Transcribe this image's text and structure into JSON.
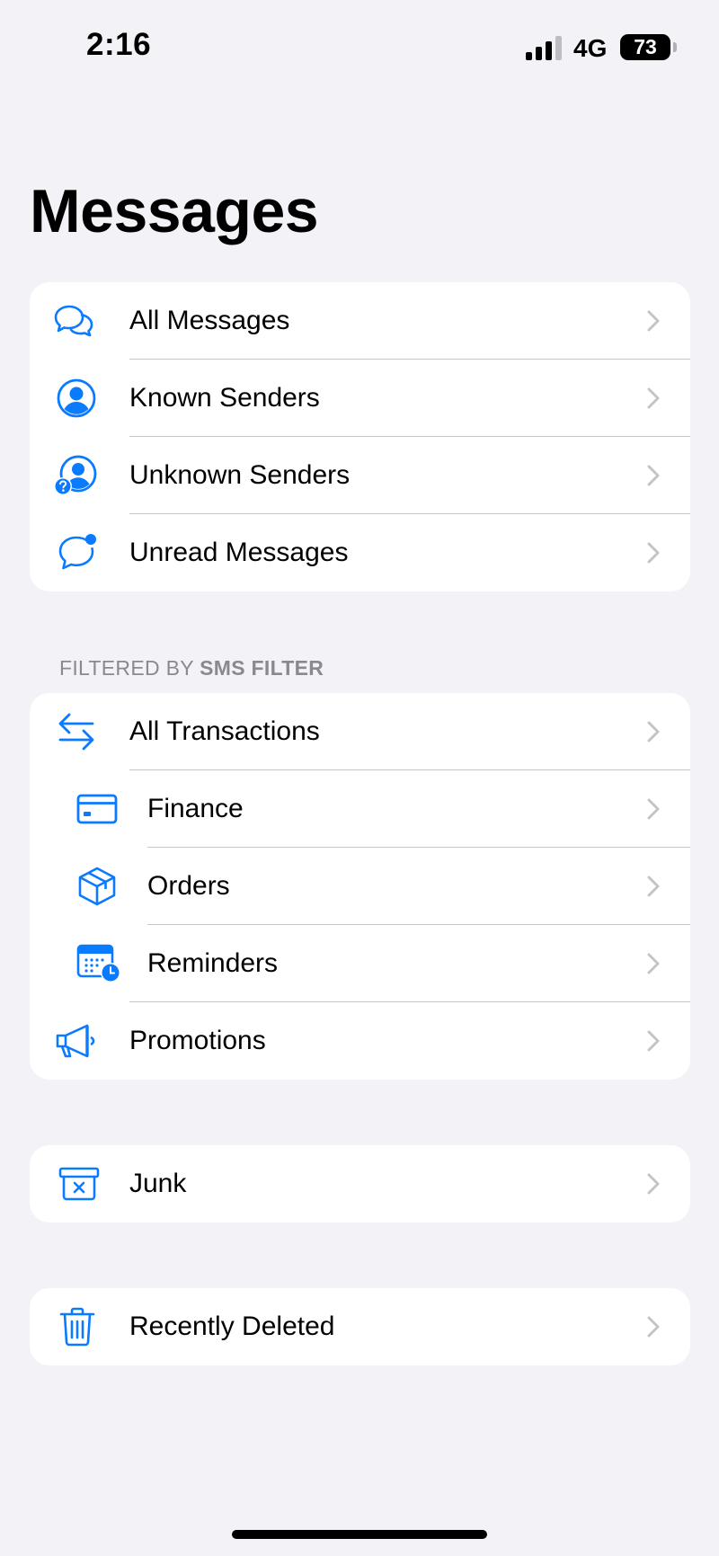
{
  "status_bar": {
    "time": "2:16",
    "network": "4G",
    "battery": "73"
  },
  "title": "Messages",
  "groups": {
    "main": [
      {
        "label": "All Messages",
        "icon": "chat-bubbles-icon"
      },
      {
        "label": "Known Senders",
        "icon": "person-circle-icon"
      },
      {
        "label": "Unknown Senders",
        "icon": "person-question-icon"
      },
      {
        "label": "Unread Messages",
        "icon": "chat-unread-icon"
      }
    ],
    "filter_header_prefix": "FILTERED BY ",
    "filter_header_bold": "SMS FILTER",
    "filtered": [
      {
        "label": "All Transactions",
        "icon": "arrows-swap-icon"
      },
      {
        "label": "Finance",
        "icon": "credit-card-icon"
      },
      {
        "label": "Orders",
        "icon": "box-icon"
      },
      {
        "label": "Reminders",
        "icon": "calendar-clock-icon"
      },
      {
        "label": "Promotions",
        "icon": "megaphone-icon"
      }
    ],
    "junk": {
      "label": "Junk",
      "icon": "trash-x-icon"
    },
    "deleted": {
      "label": "Recently Deleted",
      "icon": "trash-icon"
    }
  },
  "colors": {
    "accent": "#0A7AFF",
    "background": "#F2F2F7",
    "chevron": "#C4C4C7",
    "separator": "#C6C6C8",
    "section_header": "#8A8A8E"
  }
}
